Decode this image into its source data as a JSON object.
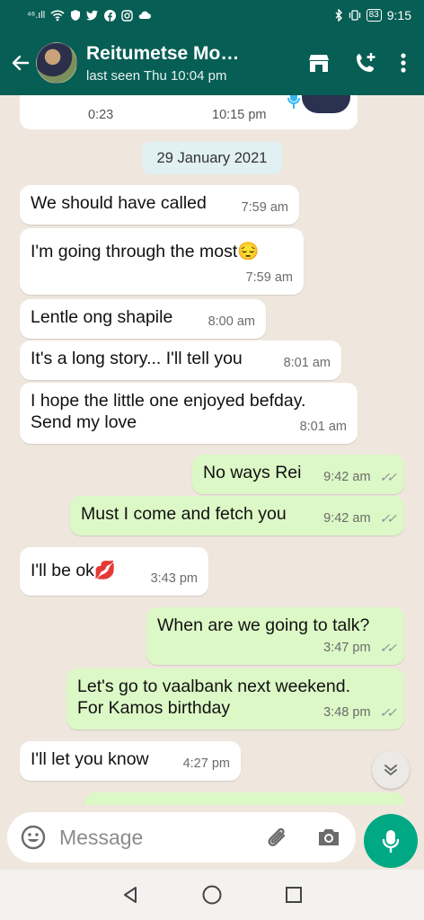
{
  "status_bar": {
    "signal": "⁴⁶.ıll",
    "time": "9:15",
    "battery": "83"
  },
  "header": {
    "contact_name": "Reitumetse Mo…",
    "last_seen": "last seen Thu 10:04 pm"
  },
  "voice_note": {
    "duration": "0:23",
    "time": "10:15 pm"
  },
  "date_chip": "29 January 2021",
  "messages": [
    {
      "dir": "in",
      "text": "We should have called",
      "time": "7:59 am"
    },
    {
      "dir": "in",
      "text": "I'm going through the most😔",
      "time": "7:59 am"
    },
    {
      "dir": "in",
      "text": "Lentle ong shapile",
      "time": "8:00 am"
    },
    {
      "dir": "in",
      "text": "It's a long story... I'll tell you",
      "time": "8:01 am"
    },
    {
      "dir": "in",
      "text": "I hope the little one enjoyed befday.\nSend my love",
      "time": "8:01 am"
    },
    {
      "dir": "out",
      "text": "No ways Rei",
      "time": "9:42 am"
    },
    {
      "dir": "out",
      "text": "Must I come and fetch you",
      "time": "9:42 am"
    },
    {
      "dir": "in",
      "text": "I'll be ok💋",
      "time": "3:43 pm"
    },
    {
      "dir": "out",
      "text": "When are we going to talk?",
      "time": "3:47 pm"
    },
    {
      "dir": "out",
      "text": "Let's go to vaalbank next weekend.\nFor Kamos birthday",
      "time": "3:48 pm"
    },
    {
      "dir": "in",
      "text": "I'll let you know",
      "time": "4:27 pm"
    }
  ],
  "input": {
    "placeholder": "Message"
  },
  "colors": {
    "header": "#075e54",
    "accent": "#00a884",
    "outgoing": "#dcf8c6",
    "incoming": "#ffffff",
    "wallpaper": "#efe7de"
  },
  "icons": [
    "back-arrow-icon",
    "store-icon",
    "add-call-icon",
    "more-vert-icon",
    "emoji-icon",
    "attach-icon",
    "camera-icon",
    "mic-icon",
    "chevron-down-double-icon",
    "nav-back-icon",
    "nav-home-icon",
    "nav-recents-icon"
  ]
}
